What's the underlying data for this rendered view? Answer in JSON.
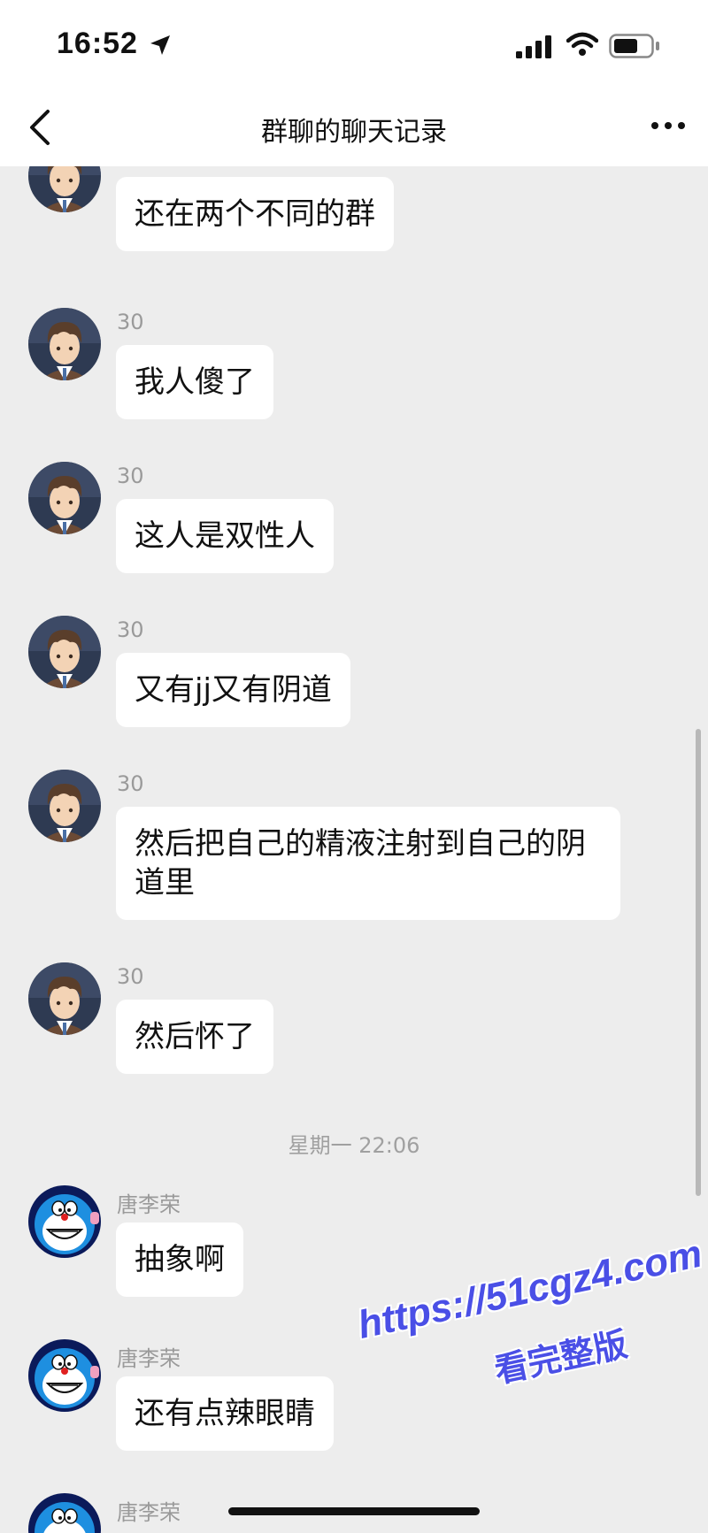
{
  "status_bar": {
    "time": "16:52",
    "icons": [
      "location-arrow-icon",
      "signal-icon",
      "wifi-icon",
      "battery-icon"
    ]
  },
  "nav": {
    "title": "群聊的聊天记录",
    "back_icon": "chevron-left-icon",
    "more_icon": "ellipsis-icon"
  },
  "messages": [
    {
      "sender": "30",
      "text": "还在两个不同的群",
      "avatar": "anime-boy-avatar"
    },
    {
      "sender": "30",
      "text": "我人傻了",
      "avatar": "anime-boy-avatar"
    },
    {
      "sender": "30",
      "text": "这人是双性人",
      "avatar": "anime-boy-avatar"
    },
    {
      "sender": "30",
      "text": "又有jj又有阴道",
      "avatar": "anime-boy-avatar"
    },
    {
      "sender": "30",
      "text": "然后把自己的精液注射到自己的阴道里",
      "avatar": "anime-boy-avatar"
    },
    {
      "sender": "30",
      "text": "然后怀了",
      "avatar": "anime-boy-avatar"
    },
    {
      "sender": "唐李荣",
      "text": "抽象啊",
      "avatar": "doraemon-avatar"
    },
    {
      "sender": "唐李荣",
      "text": "还有点辣眼睛",
      "avatar": "doraemon-avatar"
    },
    {
      "sender": "唐李荣",
      "text": "",
      "avatar": "doraemon-avatar"
    }
  ],
  "time_divider": "星期一 22:06",
  "watermark": {
    "url": "https://51cgz4.com",
    "sub": "看完整版"
  },
  "colors": {
    "background": "#ededed",
    "bubble": "#ffffff",
    "watermark": "#4a4fe6"
  }
}
